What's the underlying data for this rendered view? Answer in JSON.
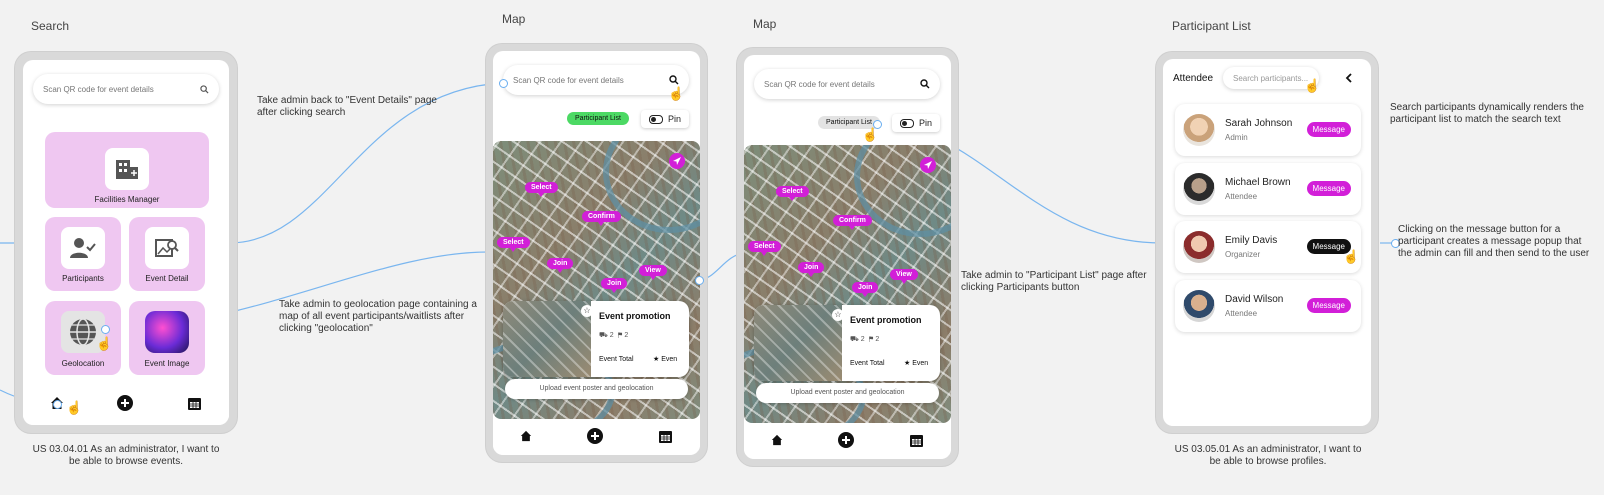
{
  "frames": {
    "search": {
      "title": "Search"
    },
    "map1": {
      "title": "Map"
    },
    "map2": {
      "title": "Map"
    },
    "participants": {
      "title": "Participant List"
    }
  },
  "search_screen": {
    "search_placeholder": "Scan QR code for event details",
    "tiles": [
      {
        "label": "Facilities Manager",
        "icon": "building-add-icon"
      },
      {
        "label": "Participants",
        "icon": "user-check-icon"
      },
      {
        "label": "Event Detail",
        "icon": "image-search-icon"
      },
      {
        "label": "Geolocation",
        "icon": "globe-icon"
      },
      {
        "label": "Event Image",
        "icon": "concert-photo"
      }
    ],
    "caption": "US 03.04.01 As an administrator, I want to be able to browse events."
  },
  "map_screen_1": {
    "search_placeholder": "Scan QR code for event details",
    "participant_list_label": "Participant List",
    "pin_label": "Pin",
    "markers": [
      "Select",
      "Confirm",
      "Select",
      "Join",
      "View",
      "Join"
    ],
    "card": {
      "title": "Event promotion",
      "stat1": "2",
      "stat2": "2",
      "total_label": "Event Total",
      "even_label": "Even"
    },
    "upload_label": "Upload event poster and geolocation"
  },
  "map_screen_2": {
    "search_placeholder": "Scan QR code for event details",
    "participant_list_label": "Participant List",
    "pin_label": "Pin",
    "markers": [
      "Select",
      "Confirm",
      "Select",
      "Join",
      "View",
      "Join"
    ],
    "card": {
      "title": "Event promotion",
      "stat1": "2",
      "stat2": "2",
      "total_label": "Event Total",
      "even_label": "Even"
    },
    "upload_label": "Upload event poster and geolocation"
  },
  "participant_screen": {
    "header_label": "Attendee",
    "search_placeholder": "Search participants...",
    "participants": [
      {
        "name": "Sarah Johnson",
        "role": "Admin",
        "button": "Message"
      },
      {
        "name": "Michael Brown",
        "role": "Attendee",
        "button": "Message"
      },
      {
        "name": "Emily Davis",
        "role": "Organizer",
        "button": "Message"
      },
      {
        "name": "David Wilson",
        "role": "Attendee",
        "button": "Message"
      }
    ],
    "caption": "US 03.05.01 As an administrator, I want to be able to browse profiles."
  },
  "notes": {
    "search_back": "Take admin back to \"Event Details\" page after clicking search",
    "geolocation": "Take admin to geolocation page containing a map of all event participants/waitlists after clicking \"geolocation\"",
    "participant_list": "Take admin to \"Participant List\" page after clicking Participants button",
    "search_participants": "Search participants dynamically renders the participant list to match the search text",
    "message": "Clicking on the message button for a participant creates a message popup that the admin can fill and then send to the user"
  },
  "colors": {
    "accent": "#d21fd8",
    "tile": "#efc7f1",
    "connector": "#6aaef0",
    "green_pill": "#4cd964"
  }
}
